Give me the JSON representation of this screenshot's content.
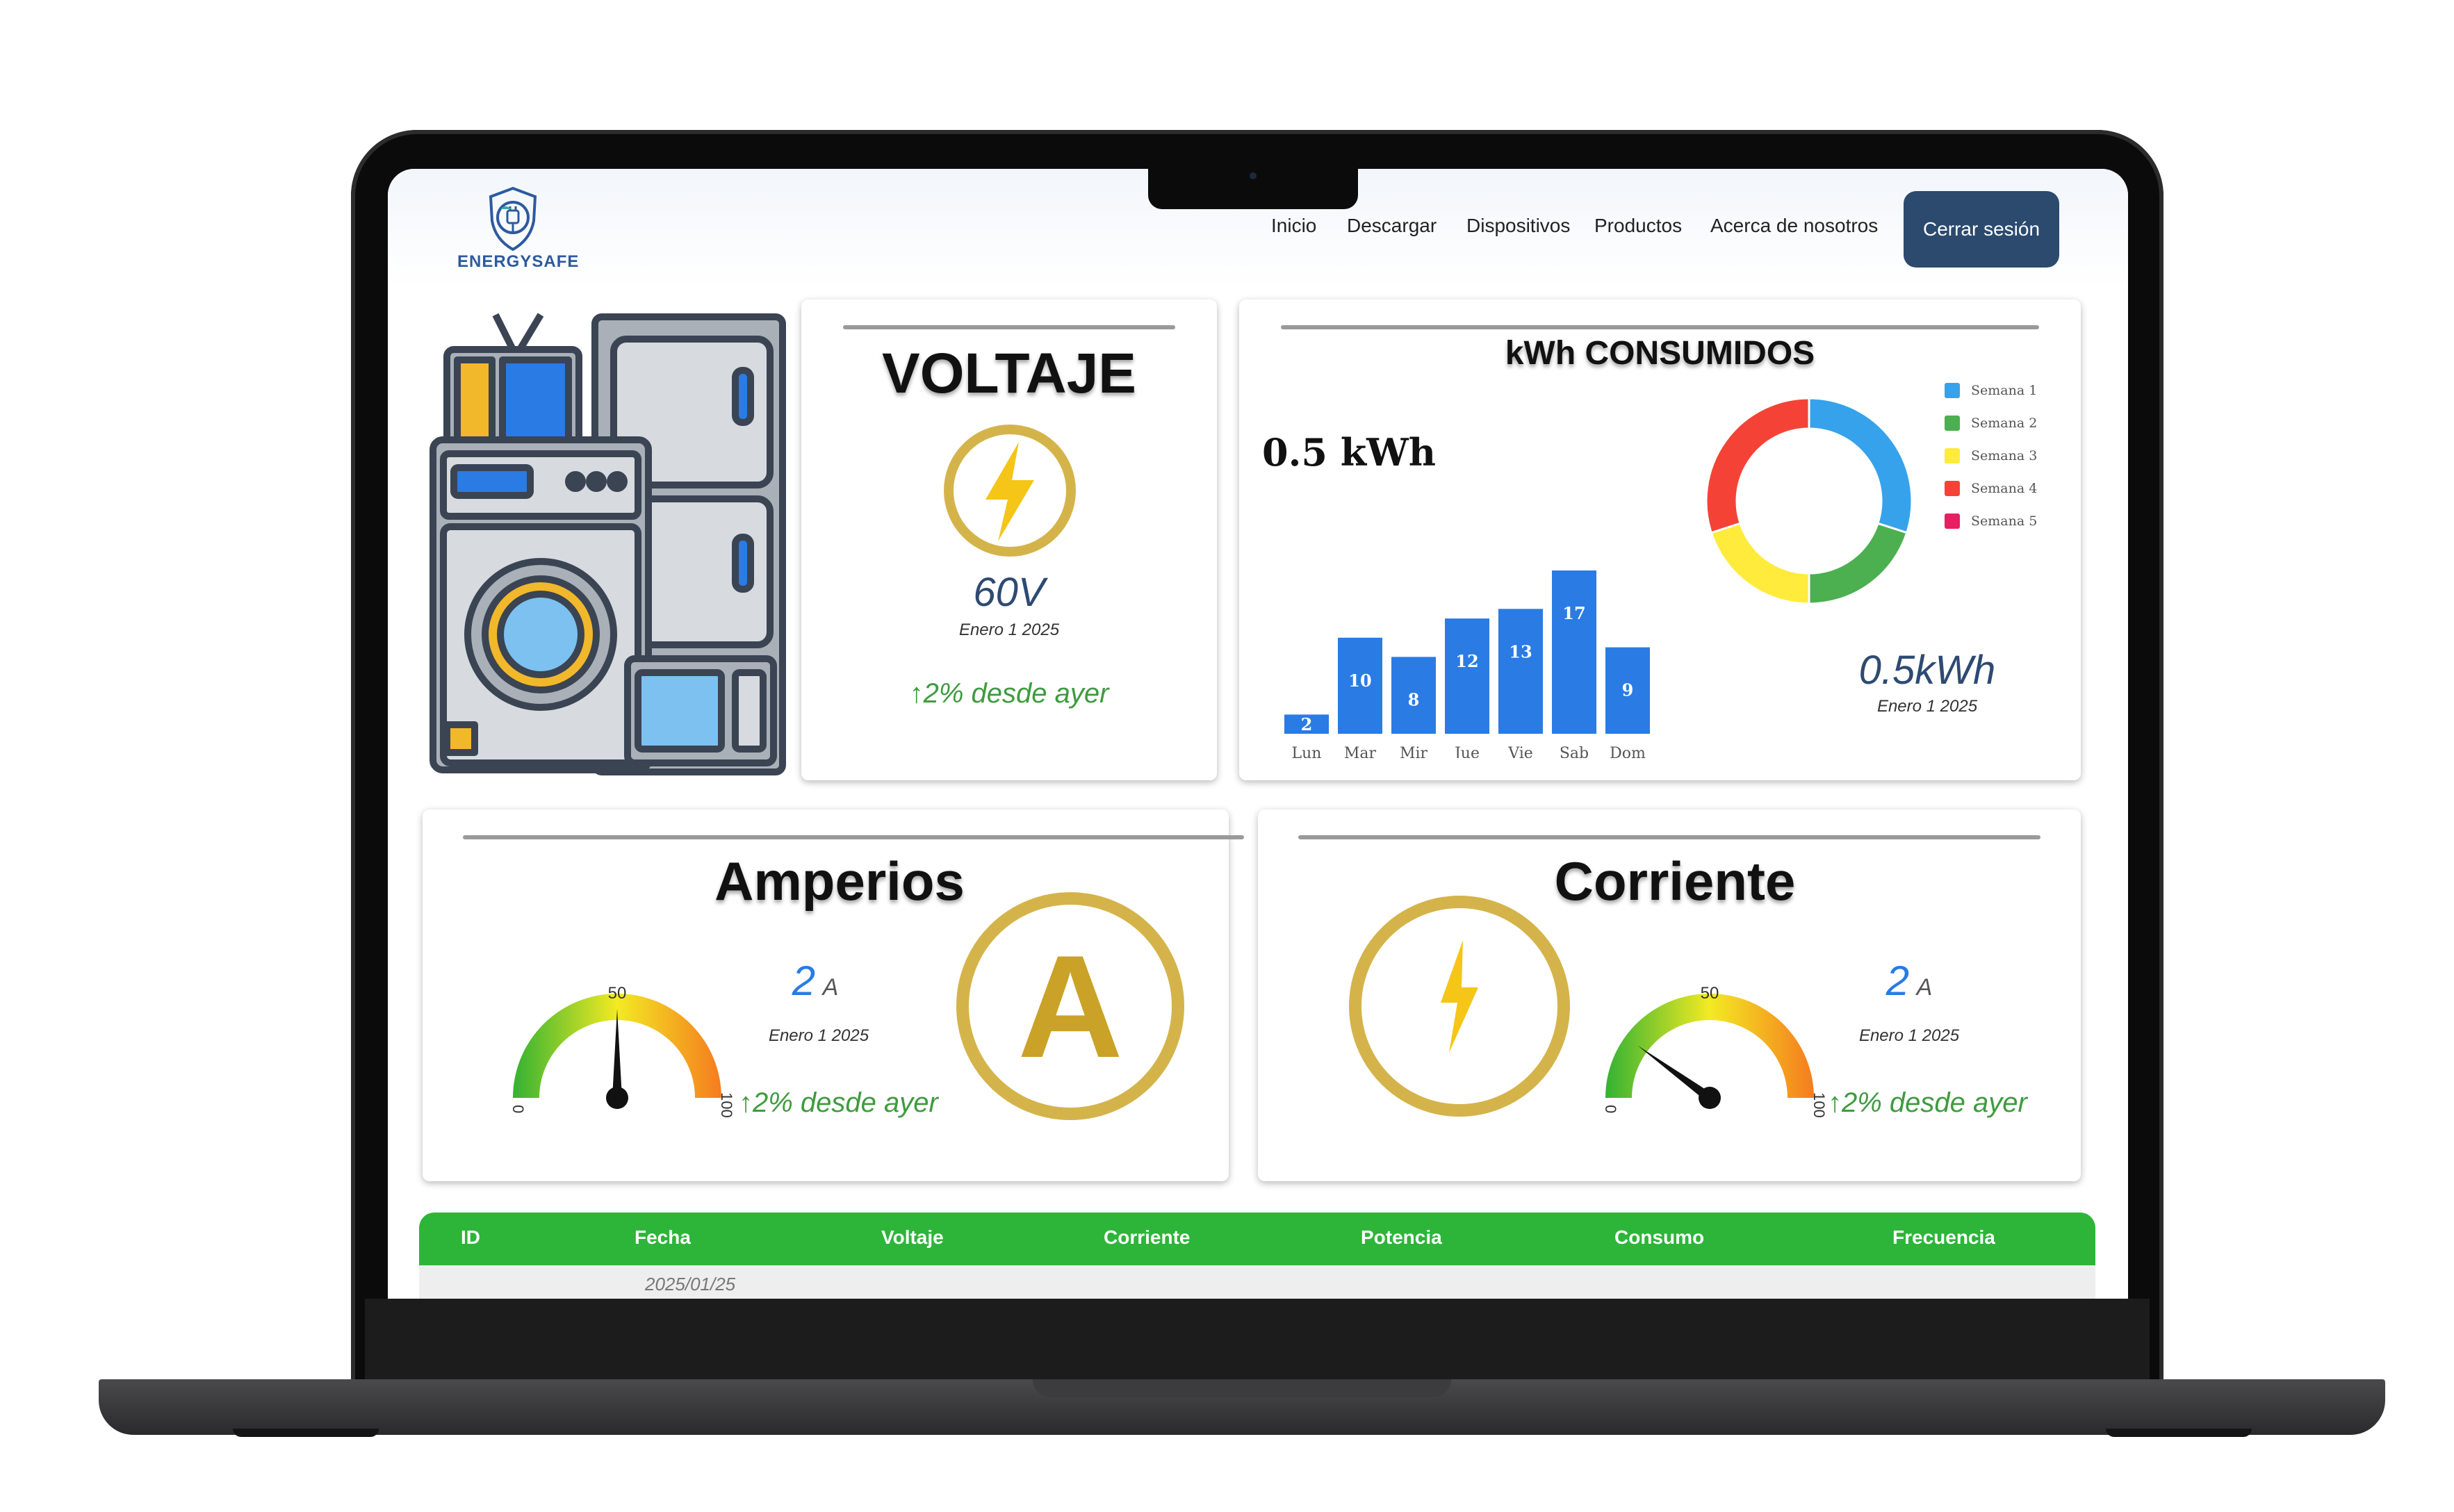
{
  "app": {
    "logo_text": "ENERGYSAFE"
  },
  "nav": {
    "items": [
      "Inicio",
      "Descargar",
      "Dispositivos",
      "Productos",
      "Acerca de nosotros"
    ],
    "logout": "Cerrar sesión"
  },
  "voltage": {
    "title": "VOLTAJE",
    "value": "60V",
    "date": "Enero 1 2025",
    "change": "↑2% desde ayer"
  },
  "kwh": {
    "title": "kWh CONSUMIDOS",
    "summary": "0.5 kWh",
    "value": "0.5kWh",
    "date": "Enero 1 2025",
    "legend": [
      "Semana 1",
      "Semana 2",
      "Semana 3",
      "Semana 4",
      "Semana 5"
    ]
  },
  "amperios": {
    "title": "Amperios",
    "value": "2",
    "unit": "A",
    "date": "Enero 1 2025",
    "change": "↑2% desde ayer",
    "gauge": {
      "min": "0",
      "mid": "50",
      "max": "100",
      "value": 50
    },
    "badge_letter": "A"
  },
  "corriente": {
    "title": "Corriente",
    "value": "2",
    "unit": "A",
    "date": "Enero 1 2025",
    "change": "↑2% desde ayer",
    "gauge": {
      "min": "0",
      "mid": "50",
      "max": "100",
      "value": 20
    }
  },
  "table": {
    "headers": [
      "ID",
      "Fecha",
      "Voltaje",
      "Corriente",
      "Potencia",
      "Consumo",
      "Frecuencia"
    ],
    "first_row_date": "2025/01/25"
  },
  "colors": {
    "accent": "#2b4a6e",
    "table_header": "#2db53a",
    "bar": "#2a7be4",
    "positive": "#3f9b3f",
    "gold": "#d4b44a"
  },
  "chart_data": [
    {
      "type": "bar",
      "categories": [
        "Lun",
        "Mar",
        "Mir",
        "Jue",
        "Vie",
        "Sab",
        "Dom"
      ],
      "values": [
        2,
        10,
        8,
        12,
        13,
        17,
        9
      ]
    },
    {
      "type": "pie",
      "categories": [
        "Semana 1",
        "Semana 2",
        "Semana 3",
        "Semana 4",
        "Semana 5"
      ],
      "values": [
        30,
        20,
        20,
        30,
        0
      ],
      "colors": [
        "#36a2eb",
        "#4caf50",
        "#ffeb3b",
        "#f44336",
        "#e91e63"
      ]
    }
  ]
}
